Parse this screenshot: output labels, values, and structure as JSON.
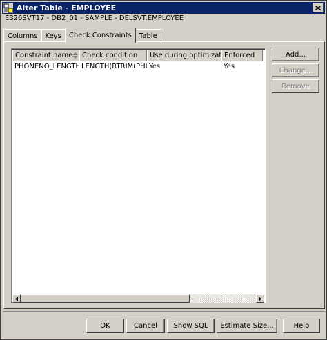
{
  "window": {
    "title": "Alter Table - EMPLOYEE",
    "path": "E326SVT17 - DB2_01 - SAMPLE - DELSVT.EMPLOYEE"
  },
  "tabs": [
    {
      "label": "Columns",
      "active": false
    },
    {
      "label": "Keys",
      "active": false
    },
    {
      "label": "Check Constraints",
      "active": true
    },
    {
      "label": "Table",
      "active": false
    }
  ],
  "grid": {
    "columns": [
      "Constraint name",
      "Check condition",
      "Use during optimization",
      "Enforced"
    ],
    "rows": [
      [
        "PHONENO_LENGTH",
        "LENGTH(RTRIM(PHO...",
        "Yes",
        "Yes"
      ]
    ]
  },
  "side_buttons": {
    "add": "Add...",
    "change": "Change...",
    "remove": "Remove"
  },
  "footer_buttons": {
    "ok": "OK",
    "cancel": "Cancel",
    "show_sql": "Show SQL",
    "estimate_size": "Estimate Size...",
    "help": "Help"
  },
  "icons": {
    "title": "table-icon",
    "close": "close-icon",
    "sort": "sort-icon",
    "scroll_left": "arrow-left-icon",
    "scroll_right": "arrow-right-icon"
  }
}
